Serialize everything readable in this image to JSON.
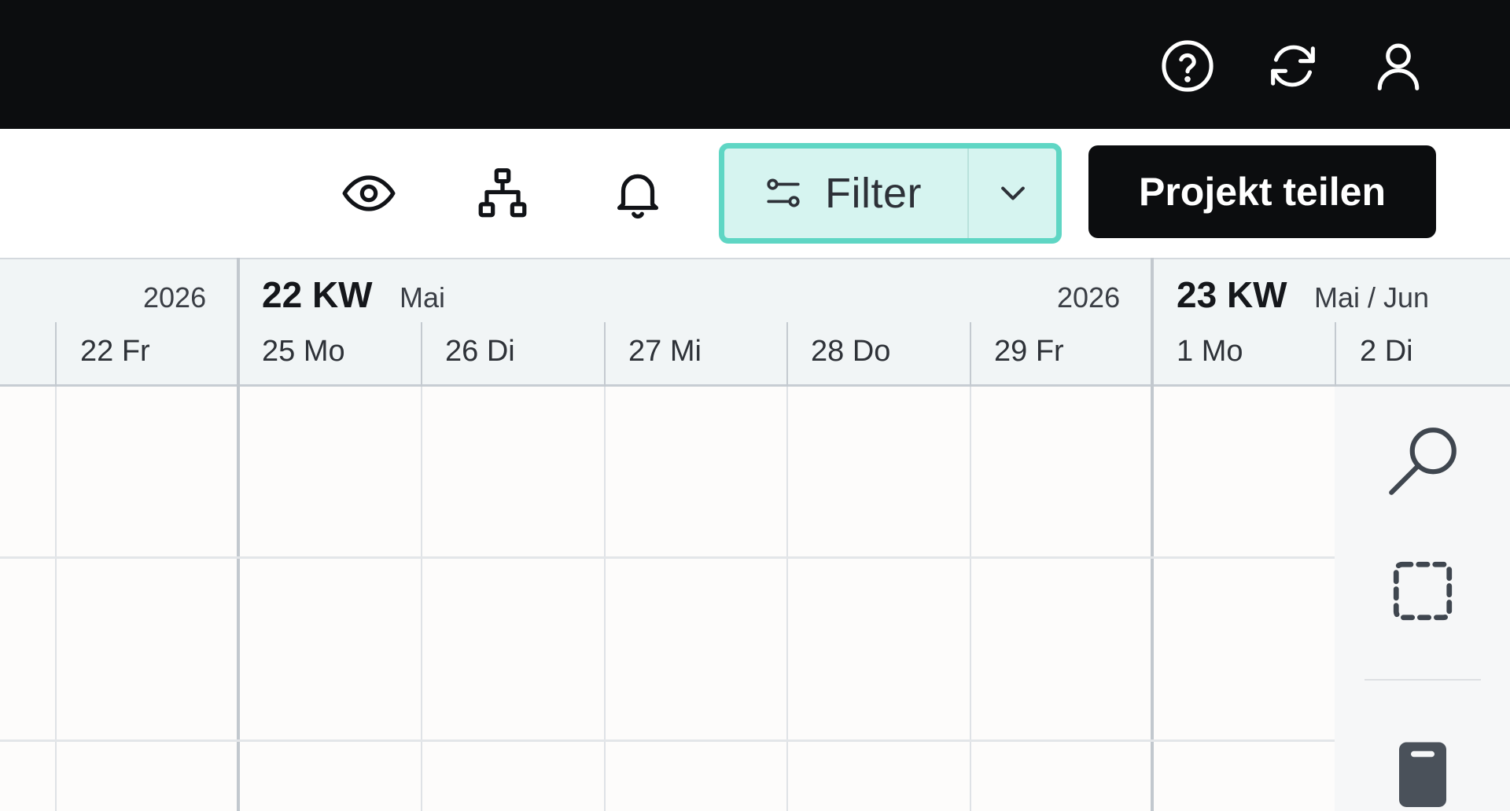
{
  "topbar": {
    "icons": [
      "help-circle-icon",
      "refresh-icon",
      "user-icon"
    ]
  },
  "toolbar": {
    "icons": [
      "eye-icon",
      "hierarchy-icon",
      "bell-icon"
    ],
    "filter": {
      "label": "Filter",
      "icon": "sliders-icon",
      "dropdown_icon": "chevron-down-icon",
      "accent": "#5fd6c4",
      "background": "#d6f4f0"
    },
    "share_label": "Projekt teilen"
  },
  "calendar": {
    "prev_week": {
      "year": "2026",
      "days": [
        "22 Fr"
      ]
    },
    "weeks": [
      {
        "label": "22 KW",
        "month": "Mai",
        "year": "2026",
        "days": [
          "25 Mo",
          "26 Di",
          "27 Mi",
          "28 Do",
          "29 Fr"
        ]
      },
      {
        "label": "23 KW",
        "month": "Mai / Jun",
        "days": [
          "1 Mo",
          "2 Di"
        ]
      }
    ]
  },
  "right_panel": {
    "icons": [
      "search-icon",
      "selection-icon",
      "notebook-icon"
    ]
  }
}
